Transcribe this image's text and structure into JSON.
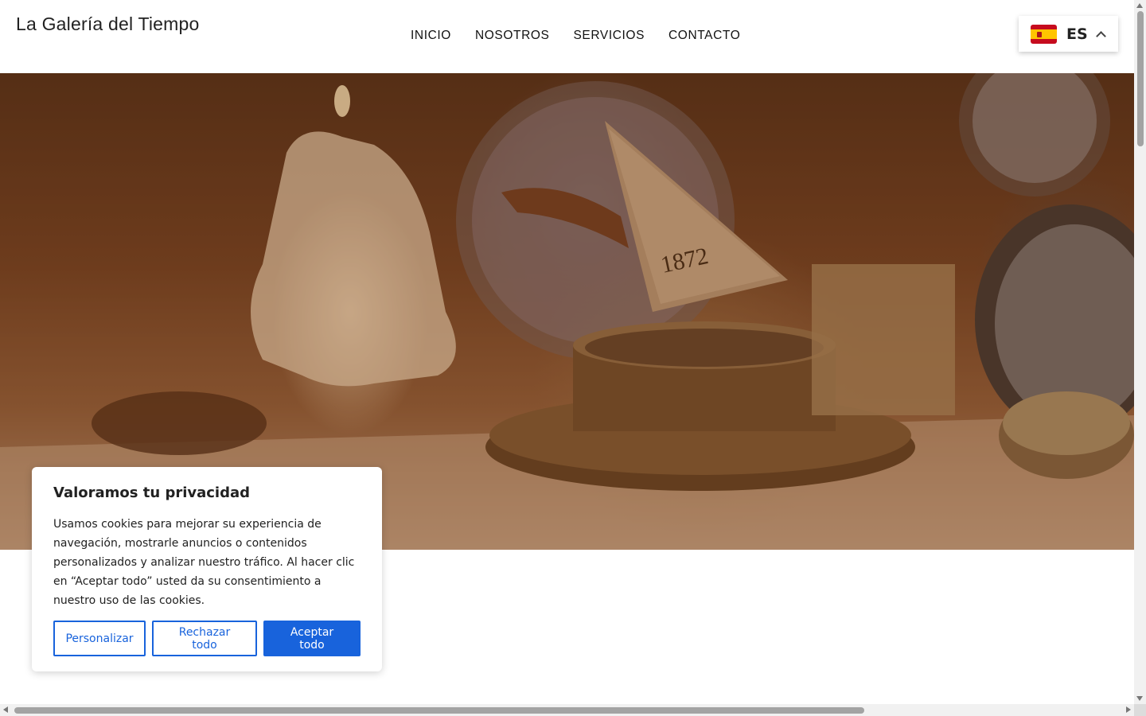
{
  "header": {
    "logo": "La Galería del Tiempo",
    "nav": [
      "INICIO",
      "NOSOTROS",
      "SERVICIOS",
      "CONTACTO"
    ],
    "language": {
      "code": "ES",
      "flag_icon": "spain-flag-icon"
    }
  },
  "hero": {
    "image_label": "1872"
  },
  "cookie_banner": {
    "title": "Valoramos tu privacidad",
    "text": "Usamos cookies para mejorar su experiencia de navegación, mostrarle anuncios o contenidos personalizados y analizar nuestro tráfico. Al hacer clic en “Aceptar todo” usted da su consentimiento a nuestro uso de las cookies.",
    "buttons": {
      "customize": "Personalizar",
      "reject": "Rechazar todo",
      "accept": "Aceptar todo"
    }
  },
  "colors": {
    "accent": "#1863dc"
  }
}
